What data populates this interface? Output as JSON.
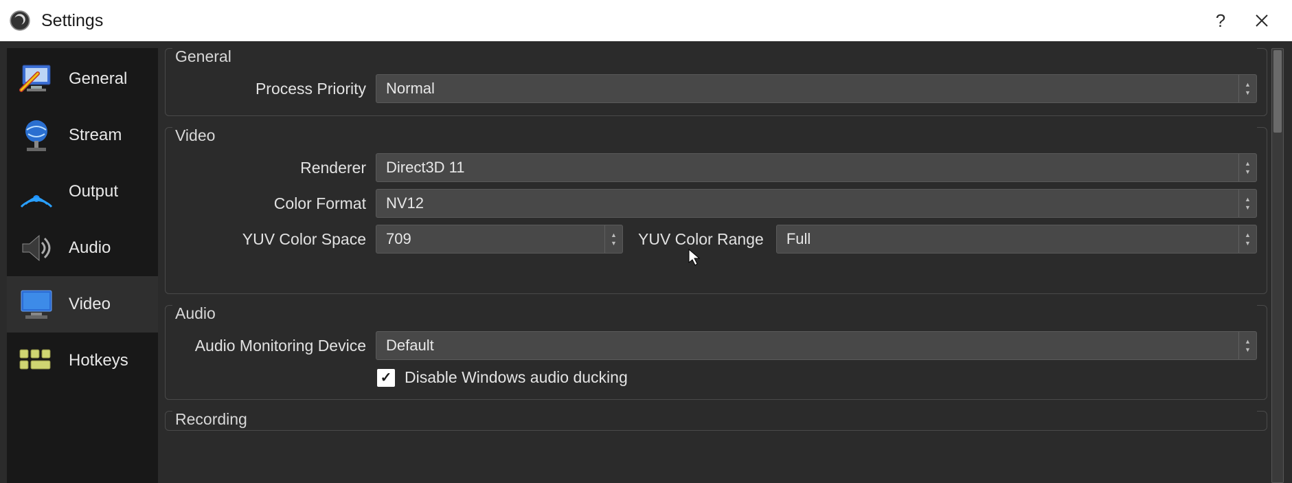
{
  "window": {
    "title": "Settings"
  },
  "sidebar": {
    "items": [
      {
        "label": "General"
      },
      {
        "label": "Stream"
      },
      {
        "label": "Output"
      },
      {
        "label": "Audio"
      },
      {
        "label": "Video"
      },
      {
        "label": "Hotkeys"
      }
    ]
  },
  "groups": {
    "general": {
      "title": "General",
      "process_priority": {
        "label": "Process Priority",
        "value": "Normal"
      }
    },
    "video": {
      "title": "Video",
      "renderer": {
        "label": "Renderer",
        "value": "Direct3D 11"
      },
      "color_format": {
        "label": "Color Format",
        "value": "NV12"
      },
      "yuv_color_space": {
        "label": "YUV Color Space",
        "value": "709"
      },
      "yuv_color_range": {
        "label": "YUV Color Range",
        "value": "Full"
      }
    },
    "audio": {
      "title": "Audio",
      "monitoring_device": {
        "label": "Audio Monitoring Device",
        "value": "Default"
      },
      "disable_ducking": {
        "label": "Disable Windows audio ducking",
        "checked": true
      }
    },
    "recording": {
      "title": "Recording"
    }
  }
}
